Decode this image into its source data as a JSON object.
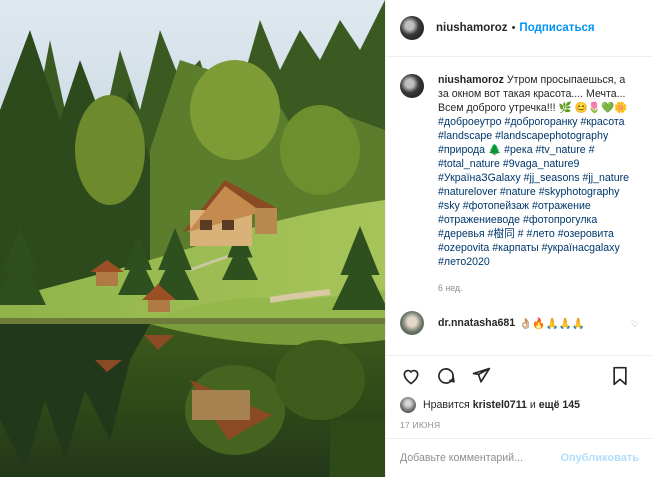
{
  "header": {
    "username": "niushamoroz",
    "dot": "•",
    "follow_label": "Подписаться"
  },
  "caption": {
    "username": "niushamoroz",
    "text": "Утром просыпаешься, а за окном вот такая красота.... Мечта... Всем доброго утречка!!! 🌿 😊🌷💚🌼",
    "hashtags": [
      "#доброеутро",
      "#доброгоранку",
      "#красота",
      "#landscape",
      "#landscapephotography",
      "#природа",
      "🌲 #река",
      "#tv_nature",
      "#",
      "#total_nature",
      "#9vaga_nature9",
      "#УкраїнаЗGalaxy",
      "#jj_seasons",
      "#jj_nature",
      "#naturelover",
      "#nature",
      "#skyphotography",
      "#sky",
      "#фотопейзаж",
      "#отражение",
      "#отражениеводе",
      "#фотопрогулка",
      "#деревья",
      "#樹同",
      "#",
      "#лето",
      "#озеровита",
      "#ozepovita",
      "#карпаты",
      "#українасgalaxy",
      "#лето2020"
    ],
    "time_ago": "6 нед."
  },
  "comment": {
    "username": "dr.nnatasha681",
    "text": "👌🏼🔥🙏🙏🙏",
    "like_icon": "heart-icon"
  },
  "actions": {
    "icons": [
      "heart-icon",
      "comment-icon",
      "share-icon",
      "bookmark-icon"
    ]
  },
  "likes": {
    "prefix": "Нравится",
    "user": "kristel0711",
    "middle": "и",
    "rest": "ещё 145"
  },
  "date": "17 ИЮНЯ",
  "add_comment": {
    "placeholder": "Добавьте комментарий...",
    "publish_label": "Опубликовать"
  },
  "colors": {
    "accent": "#0095f6",
    "link": "#00376b",
    "muted": "#8e8e8e",
    "publish_disabled": "#b2dffc"
  }
}
